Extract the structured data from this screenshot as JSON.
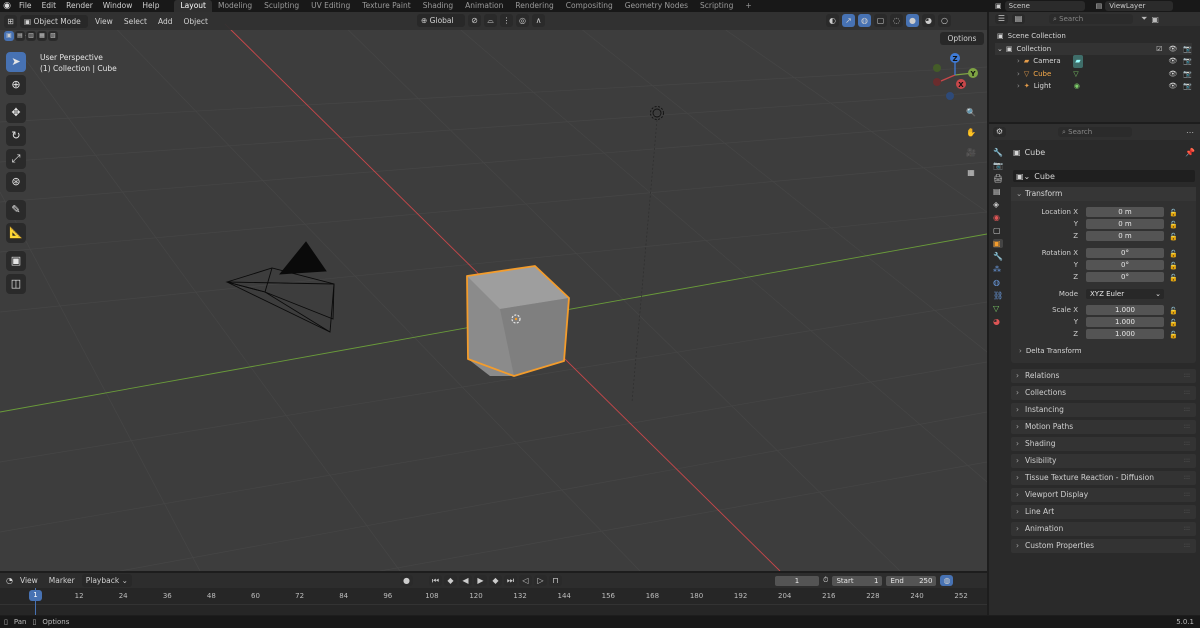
{
  "topbar": {
    "menus": [
      "File",
      "Edit",
      "Render",
      "Window",
      "Help"
    ],
    "workspaces": [
      "Layout",
      "Modeling",
      "Sculpting",
      "UV Editing",
      "Texture Paint",
      "Shading",
      "Animation",
      "Rendering",
      "Compositing",
      "Geometry Nodes",
      "Scripting"
    ],
    "active_workspace": "Layout",
    "add_tab": "+",
    "scene": "Scene",
    "view_layer": "ViewLayer"
  },
  "viewport": {
    "mode": "Object Mode",
    "menus": [
      "View",
      "Select",
      "Add",
      "Object"
    ],
    "transform_orientation": "Global",
    "options": "Options",
    "overlay_title": "User Perspective",
    "overlay_subtitle": "(1) Collection | Cube",
    "gizmo": {
      "x": "X",
      "y": "Y",
      "z": "Z"
    }
  },
  "outliner": {
    "search_placeholder": "Search",
    "root": "Scene Collection",
    "collection": "Collection",
    "items": [
      {
        "name": "Camera",
        "color": "#e49c4a",
        "icon": "camera-icon"
      },
      {
        "name": "Cube",
        "color": "#e49c4a",
        "icon": "mesh-icon"
      },
      {
        "name": "Light",
        "color": "#e49c4a",
        "icon": "light-icon"
      }
    ]
  },
  "properties": {
    "search_placeholder": "Search",
    "object_name": "Cube",
    "datablock_name": "Cube",
    "transform": {
      "title": "Transform",
      "location_label": "Location X",
      "location": [
        "0 m",
        "0 m",
        "0 m"
      ],
      "rotation_label": "Rotation X",
      "rotation": [
        "0°",
        "0°",
        "0°"
      ],
      "mode_label": "Mode",
      "mode": "XYZ Euler",
      "scale_label": "Scale X",
      "scale": [
        "1.000",
        "1.000",
        "1.000"
      ],
      "y_label": "Y",
      "z_label": "Z",
      "delta": "Delta Transform"
    },
    "sections": [
      "Relations",
      "Collections",
      "Instancing",
      "Motion Paths",
      "Shading",
      "Visibility",
      "Tissue Texture Reaction - Diffusion",
      "Viewport Display",
      "Line Art",
      "Animation",
      "Custom Properties"
    ]
  },
  "timeline": {
    "menus": [
      "View",
      "Marker",
      "Playback"
    ],
    "current_frame": "1",
    "start_label": "Start",
    "start": "1",
    "end_label": "End",
    "end": "250",
    "ticks": [
      "1",
      "12",
      "24",
      "36",
      "48",
      "60",
      "72",
      "84",
      "96",
      "108",
      "120",
      "132",
      "144",
      "156",
      "168",
      "180",
      "192",
      "204",
      "216",
      "228",
      "240",
      "252"
    ],
    "playhead": "1"
  },
  "statusbar": {
    "left1": "Pan",
    "left2": "Options",
    "version": "5.0.1"
  },
  "colors": {
    "accent": "#4772b3",
    "selection": "#f39c2c",
    "x_axis": "#c8474a",
    "y_axis": "#6a9c3a",
    "z_axis": "#3f7bd6"
  }
}
